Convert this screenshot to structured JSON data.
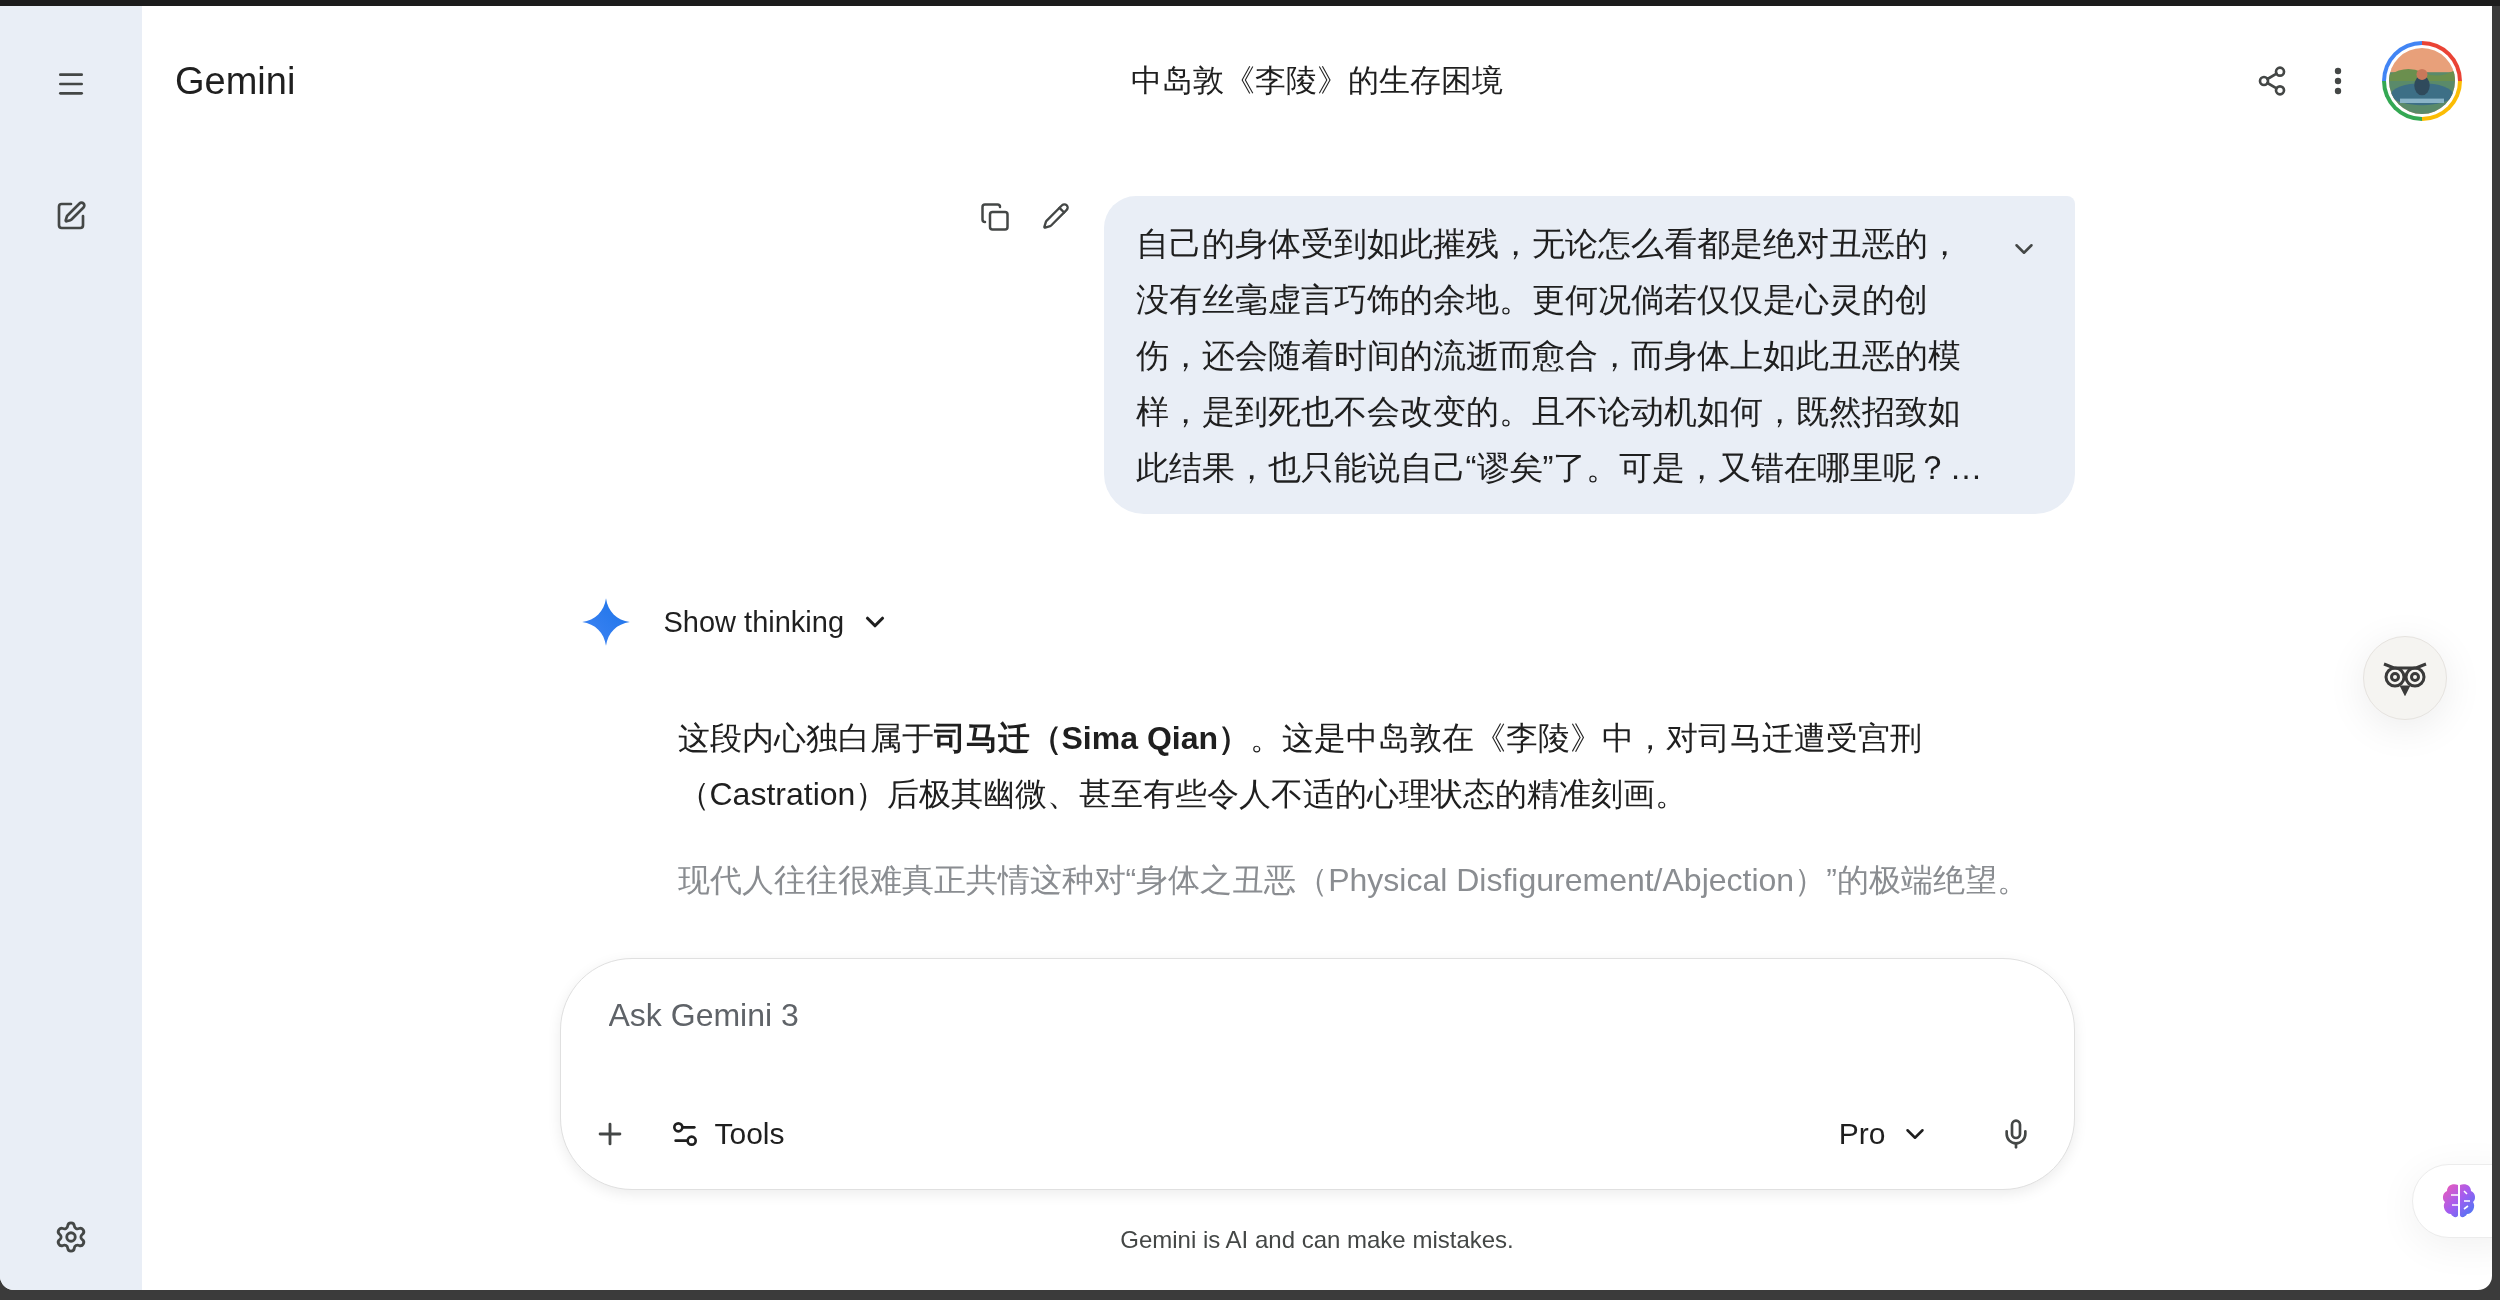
{
  "header": {
    "app_name": "Gemini",
    "title": "中岛敦《李陵》的生存困境"
  },
  "user_message": {
    "lines": [
      "自己的身体受到如此摧残，无论怎么看都是绝对丑恶的，",
      "没有丝毫虚言巧饰的余地。更何况倘若仅仅是心灵的创",
      "伤，还会随着时间的流逝而愈合，而身体上如此丑恶的模",
      "样，是到死也不会改变的。且不论动机如何，既然招致如",
      "此结果，也只能说自己“谬矣”了。可是，又错在哪里呢？…"
    ]
  },
  "response": {
    "thinking_label": "Show thinking",
    "paragraphs": [
      {
        "kind": "normal",
        "lines": [
          "这段内心独白属于**司马迁（Sima Qian）**。这是中岛敦在《李陵》中，对司马迁遭受宫刑",
          "（Castration）后极其幽微、甚至有些令人不适的心理状态的精准刻画。"
        ]
      },
      {
        "kind": "faded",
        "lines": [
          "现代人往往很难真正共情这种对“身体之丑恶（Physical Disfigurement/Abjection）”的极端绝望。"
        ]
      }
    ]
  },
  "composer": {
    "placeholder": "Ask Gemini 3",
    "tools_label": "Tools",
    "model": "Pro"
  },
  "disclaimer": "Gemini is AI and can make mistakes."
}
